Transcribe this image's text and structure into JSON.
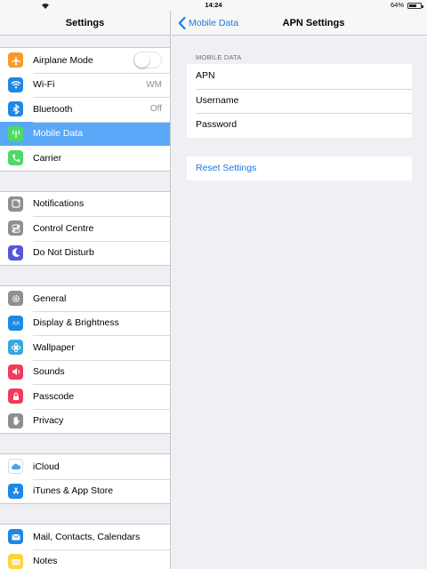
{
  "status_bar": {
    "time": "14:24",
    "battery": "64%",
    "battery_level": 0.64
  },
  "sidebar": {
    "title": "Settings",
    "groups": [
      [
        {
          "label": "Airplane Mode",
          "icon": "airplane-icon",
          "color": "#f79a2a",
          "toggle": false
        },
        {
          "label": "Wi-Fi",
          "value": "WM",
          "icon": "wifi-icon",
          "color": "#1e88e5"
        },
        {
          "label": "Bluetooth",
          "value": "Off",
          "icon": "bluetooth-icon",
          "color": "#1e88e5"
        },
        {
          "label": "Mobile Data",
          "icon": "antenna-icon",
          "color": "#4cd964",
          "selected": true
        },
        {
          "label": "Carrier",
          "icon": "phone-icon",
          "color": "#4cd964"
        }
      ],
      [
        {
          "label": "Notifications",
          "icon": "notifications-icon",
          "color": "#8e8e93"
        },
        {
          "label": "Control Centre",
          "icon": "control-centre-icon",
          "color": "#8e8e93"
        },
        {
          "label": "Do Not Disturb",
          "icon": "moon-icon",
          "color": "#5856d6"
        }
      ],
      [
        {
          "label": "General",
          "icon": "gear-icon",
          "color": "#8e8e93"
        },
        {
          "label": "Display & Brightness",
          "icon": "display-icon",
          "color": "#1e88e5"
        },
        {
          "label": "Wallpaper",
          "icon": "wallpaper-icon",
          "color": "#35a9e0"
        },
        {
          "label": "Sounds",
          "icon": "speaker-icon",
          "color": "#f23a5c"
        },
        {
          "label": "Passcode",
          "icon": "lock-icon",
          "color": "#f23a5c"
        },
        {
          "label": "Privacy",
          "icon": "hand-icon",
          "color": "#8e8e93"
        }
      ],
      [
        {
          "label": "iCloud",
          "icon": "cloud-icon",
          "color": "#ffffff"
        },
        {
          "label": "iTunes & App Store",
          "icon": "app-store-icon",
          "color": "#1e88e5"
        }
      ],
      [
        {
          "label": "Mail, Contacts, Calendars",
          "icon": "mail-icon",
          "color": "#1e88e5"
        },
        {
          "label": "Notes",
          "icon": "notes-icon",
          "color": "#ffd33d"
        }
      ]
    ]
  },
  "detail": {
    "back_label": "Mobile Data",
    "title": "APN Settings",
    "section_header": "MOBILE DATA",
    "fields": [
      "APN",
      "Username",
      "Password"
    ],
    "reset_label": "Reset Settings"
  }
}
